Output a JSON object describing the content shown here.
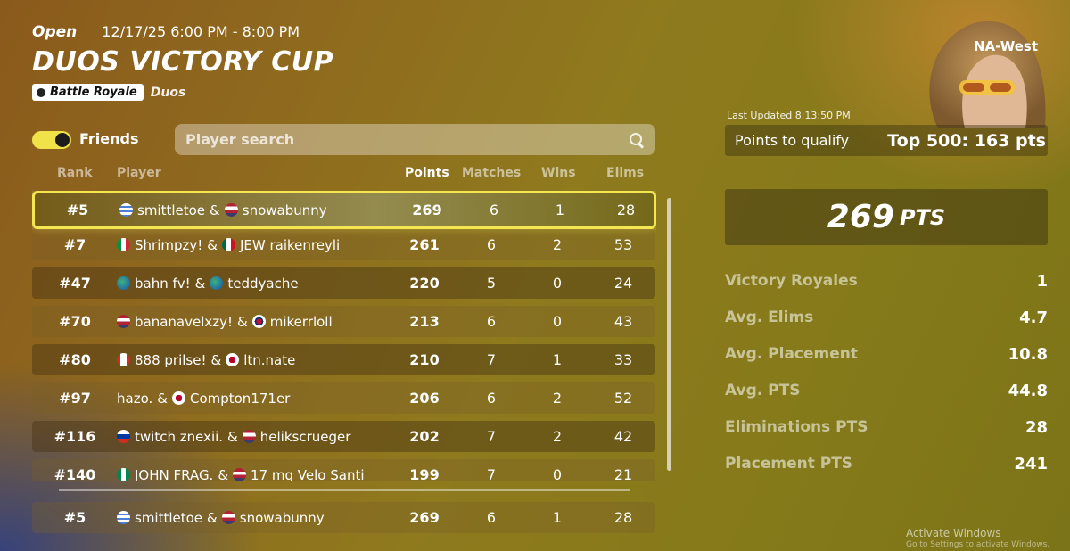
{
  "header": {
    "status": "Open",
    "datetime": "12/17/25 6:00 PM - 8:00 PM",
    "title": "DUOS VICTORY CUP",
    "mode": "Battle Royale",
    "mode_sub": "Duos"
  },
  "friends": {
    "label": "Friends",
    "toggle_on": true
  },
  "search": {
    "placeholder": "Player search",
    "value": ""
  },
  "columns": {
    "rank": "Rank",
    "player": "Player",
    "points": "Points",
    "matches": "Matches",
    "wins": "Wins",
    "elims": "Elims"
  },
  "rows": [
    {
      "rank": "#5",
      "p1": "smittletoe",
      "p2": "snowabunny",
      "f1": "uruguay",
      "f2": "usa",
      "points": "269",
      "matches": "6",
      "wins": "1",
      "elims": "28"
    },
    {
      "rank": "#7",
      "p1": "Shrimpzy!",
      "p2": "JEW raikenreyli",
      "f1": "italy",
      "f2": "mexico",
      "points": "261",
      "matches": "6",
      "wins": "2",
      "elims": "53"
    },
    {
      "rank": "#47",
      "p1": "bahn fv!",
      "p2": "teddyache",
      "f1": "globe",
      "f2": "globe",
      "points": "220",
      "matches": "5",
      "wins": "0",
      "elims": "24"
    },
    {
      "rank": "#70",
      "p1": "bananavelxzy!",
      "p2": "mikerrloll",
      "f1": "usa",
      "f2": "korea",
      "points": "213",
      "matches": "6",
      "wins": "0",
      "elims": "43"
    },
    {
      "rank": "#80",
      "p1": "888 prilse!",
      "p2": "ltn.nate",
      "f1": "canada",
      "f2": "japan",
      "points": "210",
      "matches": "7",
      "wins": "1",
      "elims": "33"
    },
    {
      "rank": "#97",
      "p1": "hazo.",
      "p2": "Compton171er",
      "f1": "",
      "f2": "japan",
      "points": "206",
      "matches": "6",
      "wins": "2",
      "elims": "52"
    },
    {
      "rank": "#116",
      "p1": "twitch znexii.",
      "p2": "helikscrueger",
      "f1": "russia",
      "f2": "usa",
      "points": "202",
      "matches": "7",
      "wins": "2",
      "elims": "42"
    },
    {
      "rank": "#140",
      "p1": "JOHN FRAG.",
      "p2": "17 mg Velo Santi",
      "f1": "nigeria",
      "f2": "usa",
      "points": "199",
      "matches": "7",
      "wins": "0",
      "elims": "21"
    }
  ],
  "my_row": {
    "rank": "#5",
    "p1": "smittletoe",
    "p2": "snowabunny",
    "f1": "uruguay",
    "f2": "usa",
    "points": "269",
    "matches": "6",
    "wins": "1",
    "elims": "28"
  },
  "right": {
    "region": "NA-West",
    "last_updated": "Last Updated 8:13:50 PM",
    "qualify_label": "Points to qualify",
    "qualify_value": "Top 500: 163 pts",
    "points_big": "269",
    "points_unit": "PTS",
    "stats": [
      {
        "label": "Victory Royales",
        "value": "1"
      },
      {
        "label": "Avg. Elims",
        "value": "4.7"
      },
      {
        "label": "Avg. Placement",
        "value": "10.8"
      },
      {
        "label": "Avg. PTS",
        "value": "44.8"
      },
      {
        "label": "Eliminations PTS",
        "value": "28"
      },
      {
        "label": "Placement PTS",
        "value": "241"
      }
    ]
  },
  "watermark": {
    "line1": "Activate Windows",
    "line2": "Go to Settings to activate Windows."
  },
  "colors": {
    "highlight": "#f3e651",
    "toggle": "#f2e24a"
  }
}
